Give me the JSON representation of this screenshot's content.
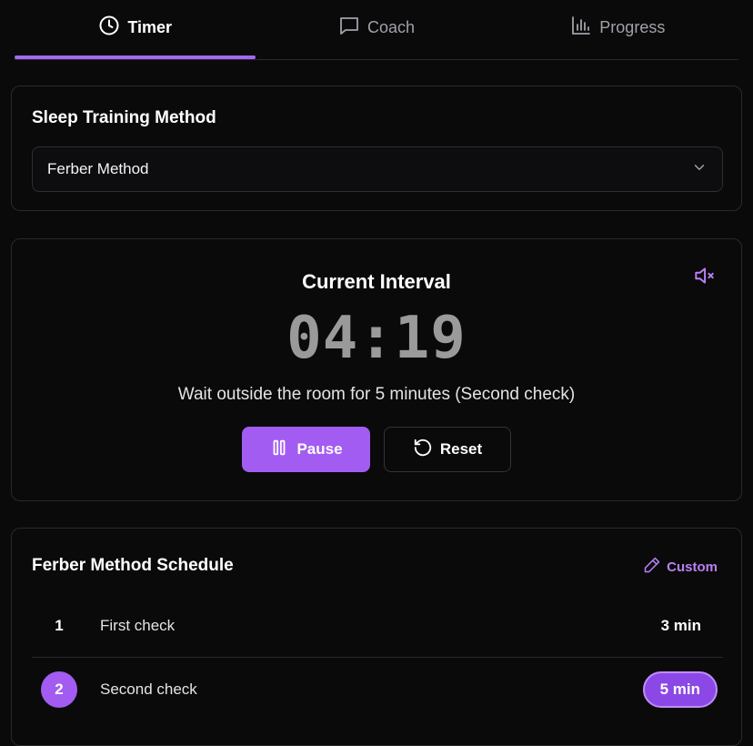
{
  "tabs": [
    {
      "label": "Timer",
      "icon": "clock-icon",
      "active": true
    },
    {
      "label": "Coach",
      "icon": "chat-icon",
      "active": false
    },
    {
      "label": "Progress",
      "icon": "bar-chart-icon",
      "active": false
    }
  ],
  "method": {
    "title": "Sleep Training Method",
    "selected": "Ferber Method"
  },
  "timer": {
    "title": "Current Interval",
    "value": "04:19",
    "instruction": "Wait outside the room for 5 minutes (Second check)",
    "pause_label": "Pause",
    "reset_label": "Reset",
    "mute_icon": "volume-mute-icon"
  },
  "schedule": {
    "title": "Ferber Method Schedule",
    "custom_label": "Custom",
    "rows": [
      {
        "num": "1",
        "label": "First check",
        "duration": "3 min",
        "active": false
      },
      {
        "num": "2",
        "label": "Second check",
        "duration": "5 min",
        "active": true
      }
    ]
  },
  "colors": {
    "accent": "#a35cf2",
    "background": "#0a0a0a",
    "border": "#2a2a2e"
  }
}
